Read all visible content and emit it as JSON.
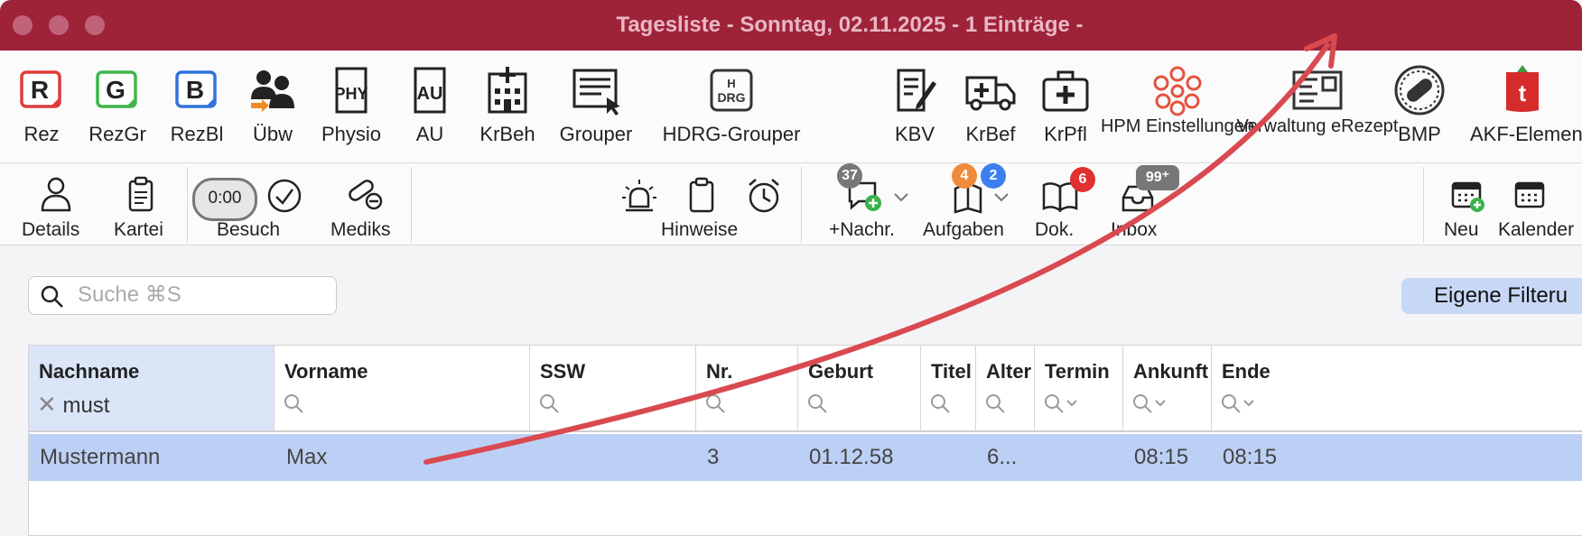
{
  "window": {
    "title": "Tagesliste - Sonntag, 02.11.2025 - 1 Einträge -"
  },
  "toolbar1": {
    "items": [
      {
        "label": "Rez"
      },
      {
        "label": "RezGr"
      },
      {
        "label": "RezBl"
      },
      {
        "label": "Übw"
      },
      {
        "label": "Physio"
      },
      {
        "label": "AU"
      },
      {
        "label": "KrBeh"
      },
      {
        "label": "Grouper"
      },
      {
        "label": "HDRG-Grouper"
      },
      {
        "label": "KBV"
      },
      {
        "label": "KrBef"
      },
      {
        "label": "KrPfl"
      },
      {
        "label": "HPM Einstellungen"
      },
      {
        "label": "Verwaltung eRezept"
      },
      {
        "label": "BMP"
      },
      {
        "label": "AKF-Elemen"
      }
    ],
    "icon_text": {
      "rez": "R",
      "rezgr": "G",
      "rezbl": "B",
      "physio": "PHY",
      "au": "AU",
      "hdrg_top": "H",
      "hdrg_bottom": "DRG",
      "akf": "t"
    }
  },
  "toolbar2": {
    "details": "Details",
    "kartei": "Kartei",
    "timer": "0:00",
    "besuch": "Besuch",
    "mediks": "Mediks",
    "hinweise": "Hinweise",
    "nachr": "+Nachr.",
    "nachr_badge": "37",
    "aufgaben": "Aufgaben",
    "aufgaben_badge1": "4",
    "aufgaben_badge2": "2",
    "dok": "Dok.",
    "dok_badge": "6",
    "inbox": "Inbox",
    "inbox_badge": "99⁺",
    "neu": "Neu",
    "kalender": "Kalender"
  },
  "search": {
    "placeholder": "Suche ⌘S",
    "value": ""
  },
  "filter_button": {
    "label": "Eigene Filteru"
  },
  "table": {
    "columns": [
      {
        "label": "Nachname",
        "filter": "must"
      },
      {
        "label": "Vorname"
      },
      {
        "label": "SSW"
      },
      {
        "label": "Nr."
      },
      {
        "label": "Geburt"
      },
      {
        "label": "Titel"
      },
      {
        "label": "Alter"
      },
      {
        "label": "Termin"
      },
      {
        "label": "Ankunft"
      },
      {
        "label": "Ende"
      }
    ],
    "rows": [
      {
        "nachname": "Mustermann",
        "vorname": "Max",
        "ssw": "",
        "nr": "3",
        "geburt": "01.12.58",
        "titel": "",
        "alter": "6...",
        "termin": "",
        "ankunft": "08:15",
        "ende": "08:15"
      }
    ]
  },
  "colors": {
    "titlebar": "#9e2339",
    "selected_row": "#bcd0f5",
    "annotation_arrow": "#d94a50",
    "badge_red": "#e0302f",
    "badge_blue": "#3d7ff0",
    "badge_orange": "#ef8a3b",
    "badge_gray": "#777777"
  }
}
